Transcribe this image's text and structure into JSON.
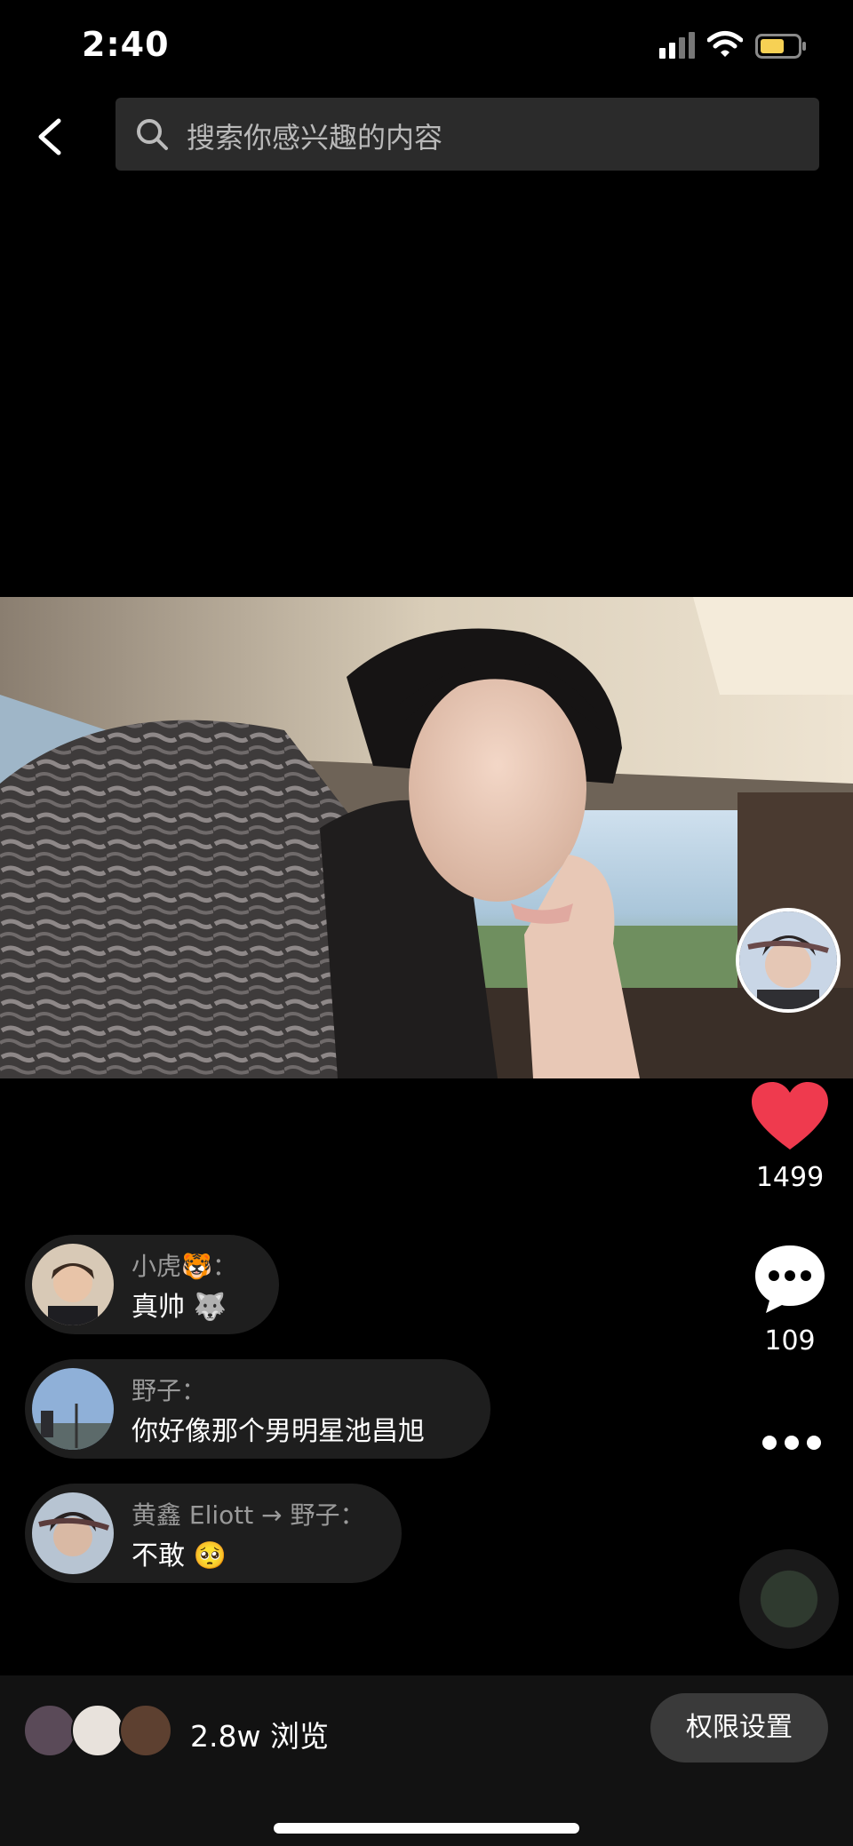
{
  "status_bar": {
    "time": "2:40",
    "signal_icon": "cellular-signal-icon",
    "wifi_icon": "wifi-icon",
    "battery_icon": "battery-icon",
    "battery_color": "#f7d154"
  },
  "search": {
    "placeholder": "搜索你感兴趣的内容",
    "icon": "search-icon"
  },
  "rail": {
    "like_count": "1499",
    "comment_count": "109",
    "like_color": "#ef3a4e"
  },
  "comments": [
    {
      "name": "小虎🐯：",
      "text": "真帅 🐺"
    },
    {
      "name": "野子：",
      "text": "你好像那个男明星池昌旭"
    },
    {
      "name": "黄鑫 Eliott → 野子：",
      "text": "不敢 🥺"
    }
  ],
  "bottom": {
    "views": "2.8w 浏览",
    "permission_button": "权限设置"
  }
}
